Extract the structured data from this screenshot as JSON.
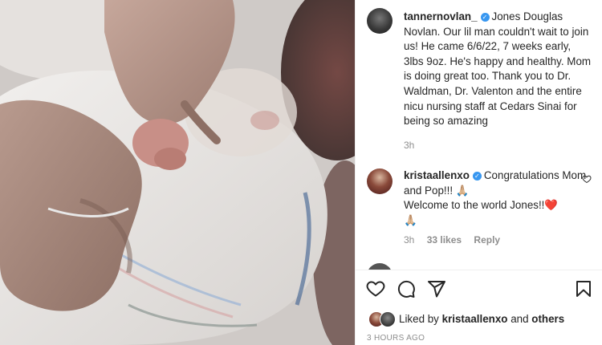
{
  "post": {
    "author": {
      "username": "tannernovlan_",
      "verified": true,
      "caption": "Jones Douglas Novlan. Our lil man couldn't wait to join us! He came 6/6/22, 7 weeks early, 3lbs 9oz. He's happy and healthy. Mom is doing great too. Thank you to Dr. Waldman, Dr. Valenton and the entire nicu nursing staff at Cedars Sinai for being so amazing",
      "time": "3h"
    },
    "comments": [
      {
        "username": "kristaallenxo",
        "verified": true,
        "line1": "Congratulations Mom and Pop!!! 🙏🏼",
        "line2": "Welcome to the world Jones!!❤️",
        "line3": "🙏🏼",
        "time": "3h",
        "likes": "33 likes",
        "reply": "Reply"
      }
    ],
    "liked_by": {
      "prefix": "Liked by",
      "user": "kristaallenxo",
      "and": "and",
      "others": "others"
    },
    "timestamp": "3 HOURS AGO"
  },
  "icons": {
    "like": "heart-icon",
    "comment": "comment-icon",
    "share": "paper-plane-icon",
    "save": "bookmark-icon",
    "comment_like": "small-heart-icon",
    "verified": "verified-badge-icon"
  },
  "colors": {
    "verified": "#3897f0",
    "text": "#262626",
    "secondary": "#8e8e8e"
  }
}
